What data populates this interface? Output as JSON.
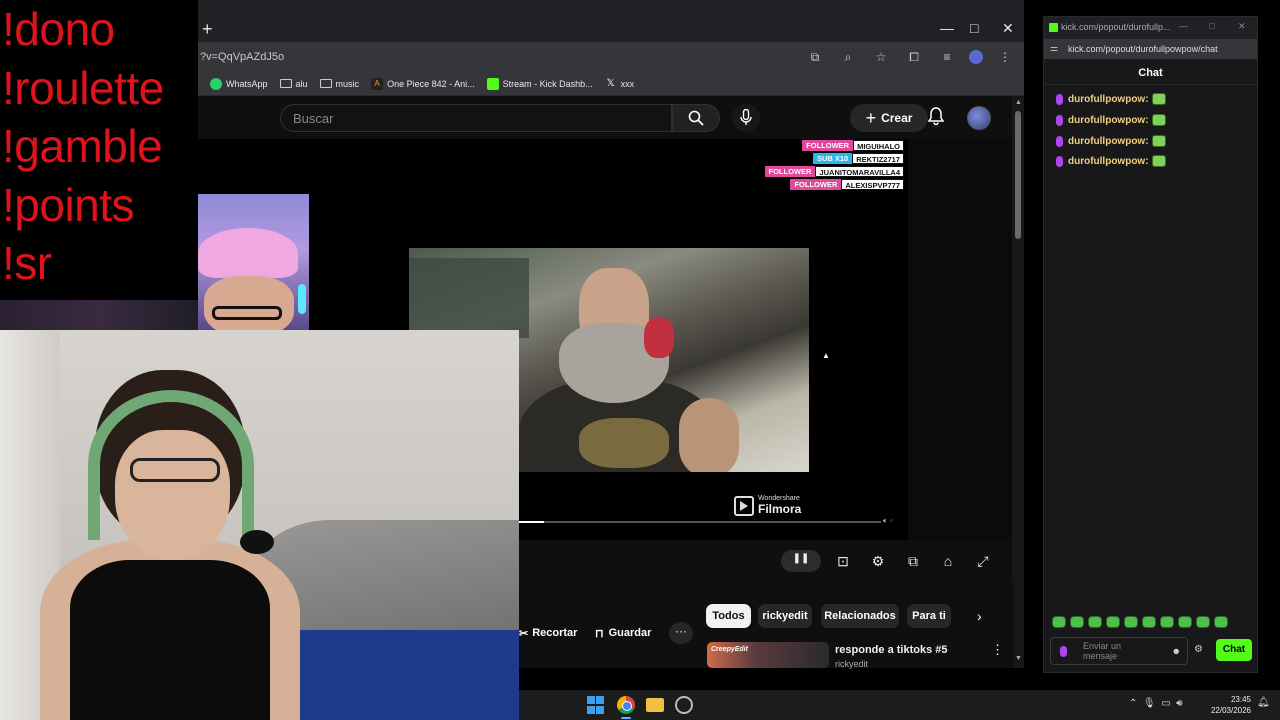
{
  "overlay": {
    "commands": [
      "!dono",
      "!roulette",
      "!gamble",
      "!points",
      "!sr"
    ]
  },
  "browser": {
    "url": "?v=QqVpAZdJ5o",
    "new_tab": "+",
    "window_controls": {
      "minimize": "—",
      "maximize": "□",
      "close": "✕"
    },
    "bookmarks": [
      {
        "label": "WhatsApp",
        "icon": "whatsapp-icon"
      },
      {
        "label": "alu",
        "icon": "folder-icon"
      },
      {
        "label": "music",
        "icon": "folder-icon"
      },
      {
        "label": "One Piece 842 - Ani...",
        "icon": "animeflv-icon"
      },
      {
        "label": "Stream - Kick Dashb...",
        "icon": "kick-icon"
      },
      {
        "label": "xxx",
        "icon": "x-icon"
      }
    ]
  },
  "youtube": {
    "search_placeholder": "Buscar",
    "create_label": "Crear",
    "alerts": [
      {
        "type": "FOLLOWER",
        "user": "MIGUIHALO",
        "color": "#e0489b"
      },
      {
        "type": "SUB X10",
        "user": "REKTIZ2717",
        "color": "#29b6e8"
      },
      {
        "type": "FOLLOWER",
        "user": "JUANITOMARAVILLA4",
        "color": "#e0489b"
      },
      {
        "type": "FOLLOWER",
        "user": "ALEXISPVP777",
        "color": "#e0489b"
      }
    ],
    "watermark": {
      "line1": "Wondershare",
      "line2": "Filmora"
    },
    "progress_fraction": 0.07,
    "chips": [
      "Todos",
      "rickyedit",
      "Relacionados",
      "Para ti"
    ],
    "actions": {
      "clip": "Recortar",
      "save": "Guardar"
    },
    "recommendation": {
      "thumb_label": "CreepyEdit",
      "title": "responde a tiktoks #5",
      "channel": "rickyedit"
    }
  },
  "chat_window": {
    "title": "kick.com/popout/durofullp...",
    "url": "kick.com/popout/durofullpowpow/chat",
    "header": "Chat",
    "messages": [
      {
        "user": "durofullpowpow:"
      },
      {
        "user": "durofullpowpow:"
      },
      {
        "user": "durofullpowpow:"
      },
      {
        "user": "durofullpowpow:"
      }
    ],
    "input_placeholder": "Enviar un mensaje",
    "send_label": "Chat",
    "accent": "#53fc18"
  },
  "taskbar": {
    "time": "23:45",
    "date": "22/03/2026"
  }
}
